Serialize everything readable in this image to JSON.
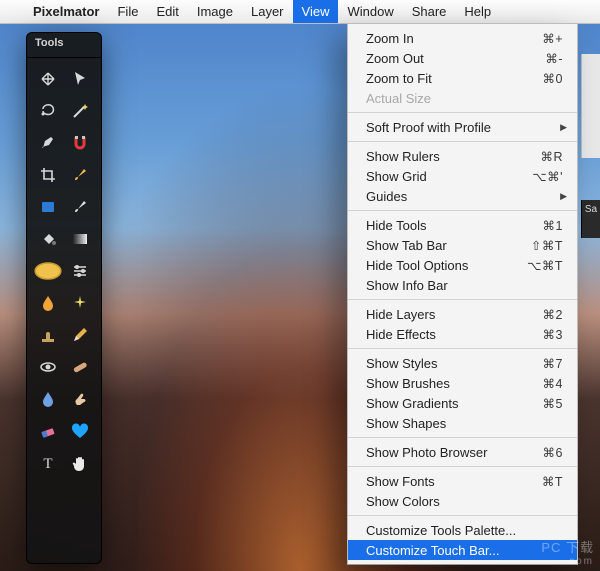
{
  "menubar": {
    "apple": "",
    "items": [
      "Pixelmator",
      "File",
      "Edit",
      "Image",
      "Layer",
      "View",
      "Window",
      "Share",
      "Help"
    ],
    "selected": "View"
  },
  "tools": {
    "title": "Tools",
    "items": [
      {
        "name": "move-tool",
        "kind": "move"
      },
      {
        "name": "pointer-tool",
        "kind": "pointer"
      },
      {
        "name": "lasso-tool",
        "kind": "lasso"
      },
      {
        "name": "wand-tool",
        "kind": "wand"
      },
      {
        "name": "pen-tool",
        "kind": "pen"
      },
      {
        "name": "magnet-tool",
        "kind": "magnet"
      },
      {
        "name": "crop-tool",
        "kind": "crop"
      },
      {
        "name": "brush-tool1",
        "kind": "brush",
        "color": "#f2b64a"
      },
      {
        "name": "marquee-tool",
        "kind": "rect"
      },
      {
        "name": "eyedrop-tool",
        "kind": "brush",
        "color": "#e0e0e0"
      },
      {
        "name": "bucket-tool",
        "kind": "bucket"
      },
      {
        "name": "gradient-tool",
        "kind": "gradient"
      },
      {
        "name": "sponge-tool",
        "kind": "sponge"
      },
      {
        "name": "adjust-tool",
        "kind": "sliders"
      },
      {
        "name": "drop-tool",
        "kind": "drop",
        "color": "#f2a438"
      },
      {
        "name": "sparkle-tool",
        "kind": "spark"
      },
      {
        "name": "stamp-tool",
        "kind": "stamp",
        "color": "#caa35a"
      },
      {
        "name": "pencil-tool",
        "kind": "pencil"
      },
      {
        "name": "eye-tool",
        "kind": "eye"
      },
      {
        "name": "heal-tool",
        "kind": "bandaid"
      },
      {
        "name": "blur-tool",
        "kind": "drop",
        "color": "#6fa0e4"
      },
      {
        "name": "smudge-tool",
        "kind": "finger"
      },
      {
        "name": "eraser-tool",
        "kind": "eraser"
      },
      {
        "name": "shape-tool",
        "kind": "heart",
        "color": "#1ea3ff"
      },
      {
        "name": "text-tool",
        "kind": "text"
      },
      {
        "name": "hand-tool",
        "kind": "hand"
      }
    ]
  },
  "drop": {
    "groups": [
      [
        {
          "label": "Zoom In",
          "sc": "⌘+"
        },
        {
          "label": "Zoom Out",
          "sc": "⌘-"
        },
        {
          "label": "Zoom to Fit",
          "sc": "⌘0"
        },
        {
          "label": "Actual Size",
          "sc": "",
          "disabled": true
        }
      ],
      [
        {
          "label": "Soft Proof with Profile",
          "sub": true
        }
      ],
      [
        {
          "label": "Show Rulers",
          "sc": "⌘R"
        },
        {
          "label": "Show Grid",
          "sc": "⌥⌘'"
        },
        {
          "label": "Guides",
          "sub": true
        }
      ],
      [
        {
          "label": "Hide Tools",
          "sc": "⌘1"
        },
        {
          "label": "Show Tab Bar",
          "sc": "⇧⌘T"
        },
        {
          "label": "Hide Tool Options",
          "sc": "⌥⌘T"
        },
        {
          "label": "Show Info Bar",
          "sc": ""
        }
      ],
      [
        {
          "label": "Hide Layers",
          "sc": "⌘2"
        },
        {
          "label": "Hide Effects",
          "sc": "⌘3"
        }
      ],
      [
        {
          "label": "Show Styles",
          "sc": "⌘7"
        },
        {
          "label": "Show Brushes",
          "sc": "⌘4"
        },
        {
          "label": "Show Gradients",
          "sc": "⌘5"
        },
        {
          "label": "Show Shapes",
          "sc": ""
        }
      ],
      [
        {
          "label": "Show Photo Browser",
          "sc": "⌘6"
        }
      ],
      [
        {
          "label": "Show Fonts",
          "sc": "⌘T"
        },
        {
          "label": "Show Colors",
          "sc": ""
        }
      ],
      [
        {
          "label": "Customize Tools Palette...",
          "sc": ""
        },
        {
          "label": "Customize Touch Bar...",
          "sc": "",
          "hover": true
        }
      ]
    ]
  },
  "watermark": {
    "big": "PC 下载",
    "small": ".com"
  },
  "bg_label": "Sa"
}
